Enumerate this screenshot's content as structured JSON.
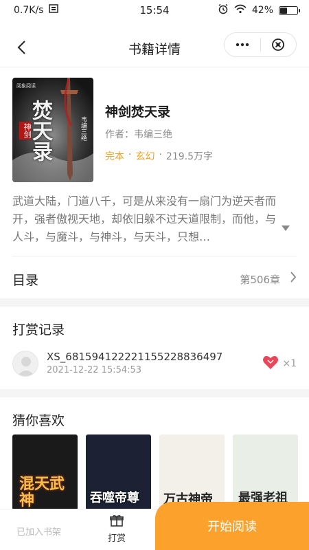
{
  "status_bar": {
    "net_speed": "0.7K/s",
    "time": "15:54",
    "battery": "42%",
    "battery_level": 0.42
  },
  "nav": {
    "title": "书籍详情"
  },
  "book": {
    "title": "神剑焚天录",
    "author": "作者：韦编三绝",
    "status": "完本",
    "genre": "玄幻",
    "word_count": "219.5万字",
    "cover_art_text": "焚天录",
    "cover_small_text": "神剑",
    "cover_author_text": "韦编三绝",
    "synopsis": "武道大陆，门道八千，可是从来没有一扇门为逆天者而开，强者傲视天地，却依旧躲不过天道限制，而他，与人斗，与魔斗，与神斗，与天斗，只想…"
  },
  "catalog": {
    "label": "目录",
    "latest_chapter": "第506章"
  },
  "rewards": {
    "title": "打赏记录",
    "records": [
      {
        "user": "XS_681594122221155228836497",
        "time": "2021-12-22 15:54:53",
        "count": "×1"
      }
    ]
  },
  "recommend": {
    "title": "猜你喜欢",
    "books": [
      {
        "cover_text": "混天武神",
        "bg": "#1a1a1a"
      },
      {
        "cover_text": "吞噬帝尊",
        "bg": "#1c2233"
      },
      {
        "cover_text": "万古神帝",
        "bg": "#f3efe9"
      },
      {
        "cover_text": "最强老祖",
        "bg": "#e9efe7"
      }
    ]
  },
  "bottom_bar": {
    "shelf_label": "已加入书架",
    "reward_label": "打赏",
    "read_label": "开始阅读"
  },
  "colors": {
    "accent": "#fca12b",
    "tag_orange": "#f0a020"
  }
}
